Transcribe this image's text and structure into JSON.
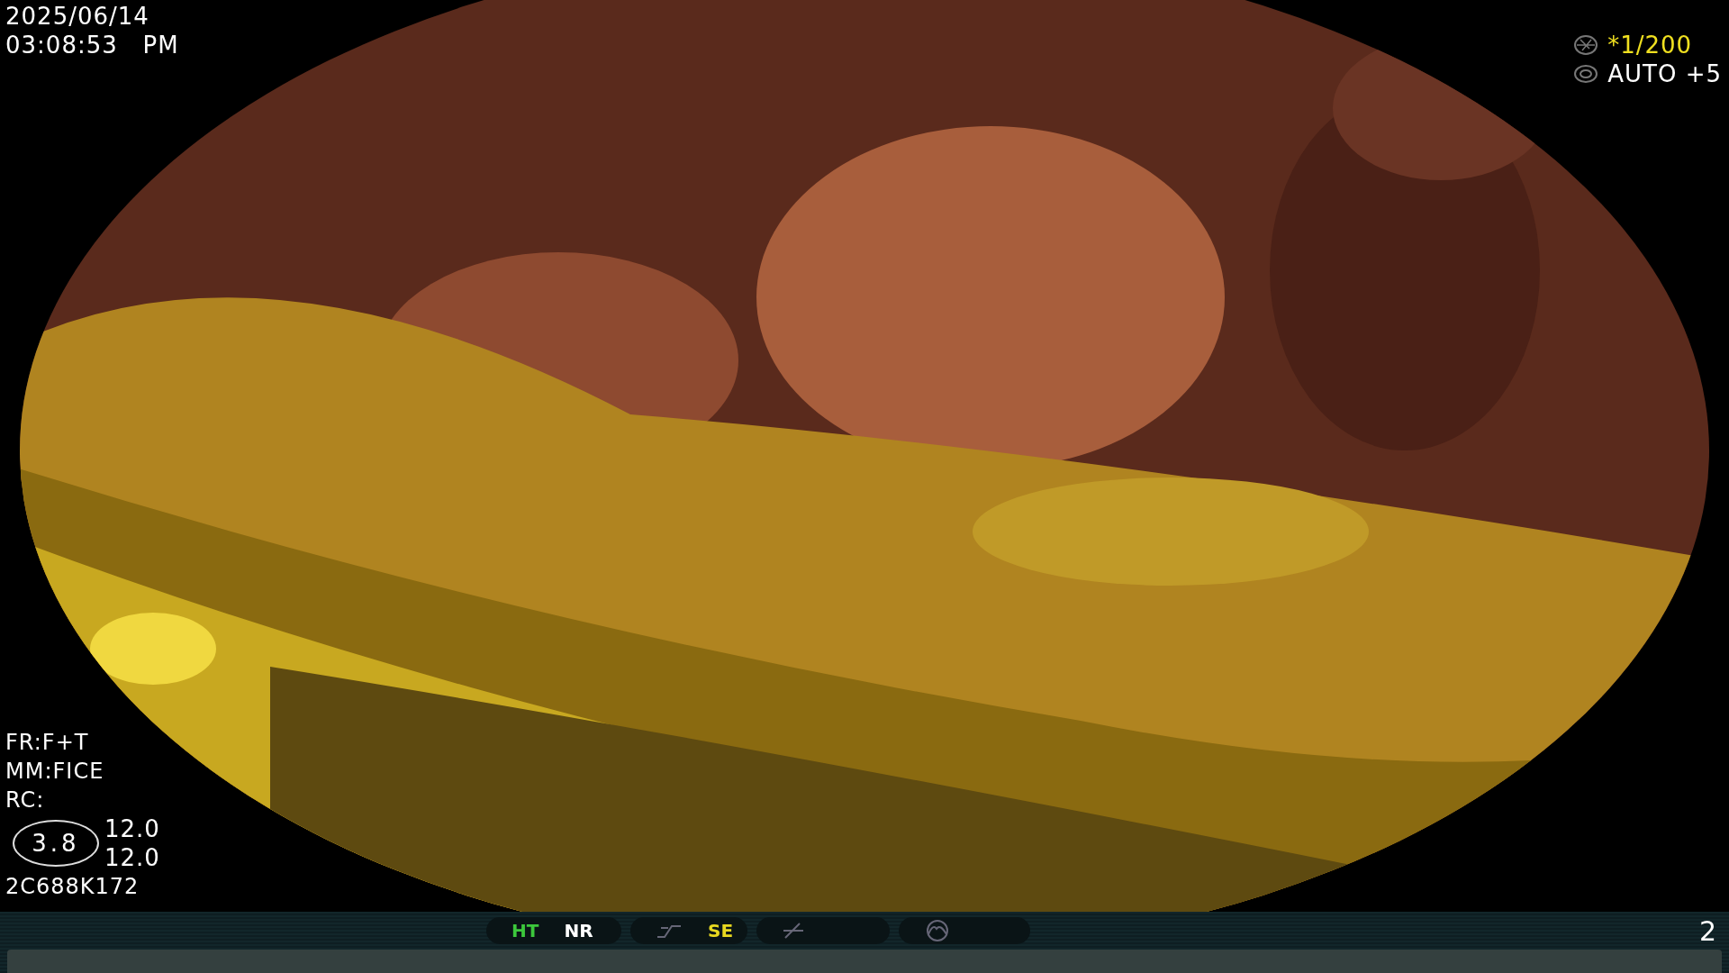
{
  "date": "2025/06/14",
  "time": "03:08:53   PM",
  "exposure": [
    {
      "text": "*1/200",
      "color": "#f0e020"
    },
    {
      "text": "AUTO +5",
      "color": "#ffffff"
    }
  ],
  "info": [
    "FR:F+T",
    "MM:FICE",
    "RC:"
  ],
  "zoom_badge": "3.8",
  "zoom_values": [
    "12.0",
    "12.0"
  ],
  "serial": "2C688K172",
  "status_bar": {
    "groups": [
      {
        "kind": "pair",
        "labels": [
          {
            "text": "HT",
            "color": "#3cc83c"
          },
          {
            "text": "NR",
            "color": "#ffffff"
          }
        ]
      },
      {
        "kind": "curve",
        "labels": [
          {
            "text": "SE",
            "color": "#e8d820"
          }
        ]
      },
      {
        "kind": "slope"
      },
      {
        "kind": "peak"
      }
    ],
    "page": "2"
  }
}
